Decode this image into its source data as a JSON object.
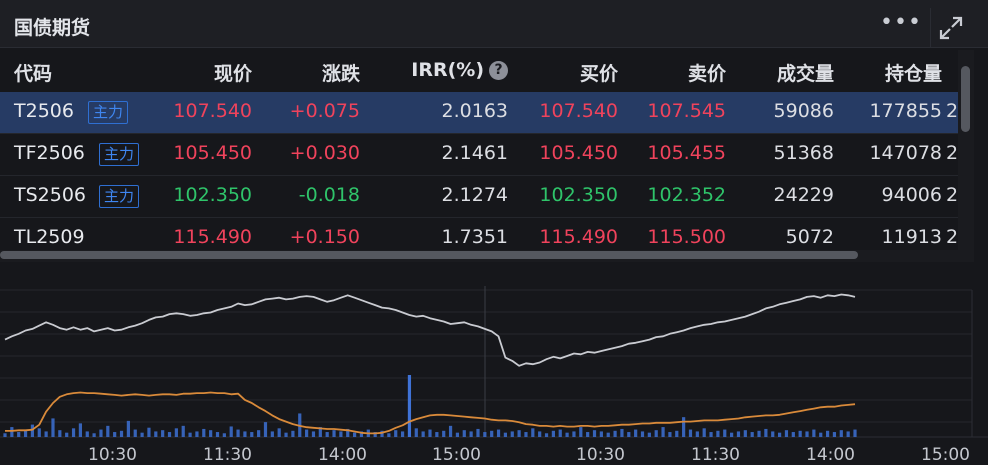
{
  "header": {
    "title": "国债期货",
    "more_icon": "more-dots-icon",
    "expand_icon": "expand-icon"
  },
  "table": {
    "columns": [
      "代码",
      "现价",
      "涨跌",
      "IRR(%)",
      "买价",
      "卖价",
      "成交量",
      "持仓量"
    ],
    "rows": [
      {
        "code": "T2506",
        "tag": "主力",
        "price": "107.540",
        "change": "+0.075",
        "irr": "2.0163",
        "bid": "107.540",
        "ask": "107.545",
        "volume": "59086",
        "oi": "177855",
        "extra": "2",
        "direction": "up",
        "selected": true
      },
      {
        "code": "TF2506",
        "tag": "主力",
        "price": "105.450",
        "change": "+0.030",
        "irr": "2.1461",
        "bid": "105.450",
        "ask": "105.455",
        "volume": "51368",
        "oi": "147078",
        "extra": "2",
        "direction": "up",
        "selected": false
      },
      {
        "code": "TS2506",
        "tag": "主力",
        "price": "102.350",
        "change": "-0.018",
        "irr": "2.1274",
        "bid": "102.350",
        "ask": "102.352",
        "volume": "24229",
        "oi": "94006",
        "extra": "2",
        "direction": "down",
        "selected": false
      },
      {
        "code": "TL2509",
        "tag": "",
        "price": "115.490",
        "change": "+0.150",
        "irr": "1.7351",
        "bid": "115.490",
        "ask": "115.500",
        "volume": "5072",
        "oi": "11913",
        "extra": "2",
        "direction": "up",
        "selected": false
      }
    ]
  },
  "colors": {
    "up": "#f0435c",
    "down": "#2fc46a",
    "price_line": "#c9cbd1",
    "avg_line": "#d98a3a",
    "volume_bar": "#3763b8",
    "selected_row": "#263b64"
  },
  "chart_data": {
    "type": "line",
    "x_ticks": [
      "10:30",
      "11:30",
      "14:00",
      "15:00",
      "10:30",
      "11:30",
      "14:00",
      "15:00"
    ],
    "series": [
      {
        "values": [
          58,
          54,
          51,
          47,
          45,
          41,
          37,
          40,
          44,
          46,
          43,
          46,
          44,
          48,
          46,
          44,
          47,
          46,
          43,
          41,
          38,
          34,
          31,
          30,
          27,
          26,
          27,
          29,
          28,
          26,
          25,
          22,
          20,
          18,
          14,
          16,
          15,
          12,
          9,
          8,
          7,
          9,
          8,
          6,
          5,
          6,
          9,
          12,
          10,
          7,
          4,
          7,
          10,
          13,
          16,
          19,
          20,
          22,
          25,
          28,
          30,
          29,
          32,
          34,
          36,
          39,
          38,
          37,
          40,
          42,
          45,
          48,
          54,
          80,
          84,
          90,
          87,
          88,
          86,
          82,
          79,
          81,
          78,
          75,
          76,
          73,
          74,
          72,
          70,
          68,
          66,
          63,
          62,
          60,
          58,
          55,
          54,
          51,
          49,
          47,
          44,
          42,
          40,
          39,
          37,
          36,
          34,
          32,
          30,
          27,
          24,
          20,
          18,
          15,
          13,
          11,
          9,
          6,
          5,
          7,
          4,
          5,
          3,
          4,
          6
        ]
      },
      {
        "values": [
          5,
          5,
          6,
          6,
          7,
          15,
          36,
          50,
          60,
          64,
          66,
          67,
          66,
          66,
          65,
          64,
          63,
          62,
          63,
          64,
          63,
          62,
          63,
          64,
          64,
          63,
          65,
          65,
          66,
          66,
          67,
          66,
          66,
          64,
          65,
          55,
          50,
          43,
          37,
          30,
          24,
          20,
          16,
          13,
          11,
          10,
          9,
          8,
          8,
          7,
          6,
          4,
          2,
          1,
          1,
          2,
          5,
          10,
          14,
          20,
          24,
          27,
          30,
          31,
          31,
          30,
          29,
          28,
          27,
          26,
          25,
          23,
          22,
          22,
          21,
          19,
          16,
          15,
          13,
          13,
          12,
          13,
          12,
          12,
          13,
          13,
          12,
          13,
          13,
          14,
          15,
          15,
          16,
          17,
          17,
          18,
          18,
          18,
          19,
          20,
          20,
          21,
          22,
          22,
          22,
          23,
          24,
          25,
          27,
          28,
          29,
          30,
          30,
          31,
          33,
          35,
          37,
          39,
          41,
          43,
          44,
          44,
          46,
          47,
          48
        ]
      }
    ],
    "volume": [
      6,
      16,
      8,
      12,
      20,
      14,
      9,
      30,
      11,
      7,
      14,
      22,
      9,
      6,
      12,
      18,
      8,
      10,
      26,
      12,
      7,
      15,
      9,
      11,
      8,
      14,
      18,
      7,
      9,
      13,
      11,
      8,
      6,
      17,
      12,
      9,
      8,
      11,
      24,
      9,
      14,
      7,
      10,
      38,
      12,
      9,
      16,
      8,
      11,
      9,
      13,
      7,
      9,
      12,
      8,
      10,
      6,
      11,
      9,
      100,
      14,
      9,
      12,
      8,
      10,
      18,
      7,
      11,
      9,
      13,
      8,
      10,
      12,
      7,
      9,
      11,
      8,
      14,
      9,
      6,
      10,
      12,
      7,
      9,
      16,
      8,
      11,
      9,
      7,
      10,
      13,
      8,
      12,
      9,
      7,
      11,
      16,
      8,
      10,
      32,
      12,
      9,
      14,
      8,
      10,
      12,
      7,
      9,
      11,
      8,
      10,
      13,
      9,
      7,
      11,
      8,
      10,
      9,
      12,
      7,
      10,
      8,
      11,
      9,
      12
    ]
  }
}
